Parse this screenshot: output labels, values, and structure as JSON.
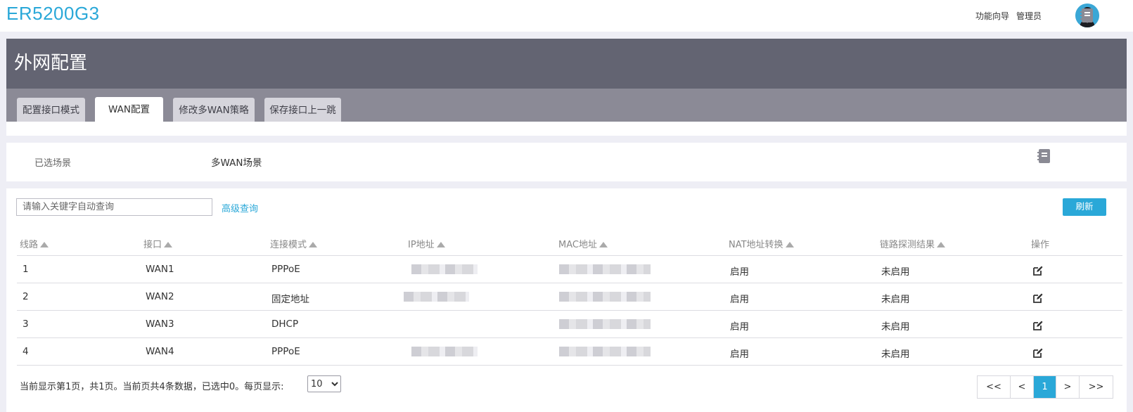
{
  "app": {
    "brand": "ER5200G3"
  },
  "topbar": {
    "wizard_link": "功能向导",
    "user_label": "管理员"
  },
  "page": {
    "title": "外网配置"
  },
  "tabs": [
    {
      "label": "配置接口模式",
      "active": false
    },
    {
      "label": "WAN配置",
      "active": true
    },
    {
      "label": "修改多WAN策略",
      "active": false
    },
    {
      "label": "保存接口上一跳",
      "active": false
    }
  ],
  "scene": {
    "label": "已选场景",
    "value": "多WAN场景"
  },
  "toolbar": {
    "search_placeholder": "请输入关键字自动查询",
    "advanced_search": "高级查询",
    "refresh": "刷新"
  },
  "table": {
    "headers": {
      "line": "线路",
      "iface": "接口",
      "mode": "连接模式",
      "ip": "IP地址",
      "mac": "MAC地址",
      "nat": "NAT地址转换",
      "probe": "链路探测结果",
      "ops": "操作"
    },
    "rows": [
      {
        "line": "1",
        "iface": "WAN1",
        "mode": "PPPoE",
        "ip_masked": true,
        "mac_masked": true,
        "nat": "启用",
        "probe": "未启用"
      },
      {
        "line": "2",
        "iface": "WAN2",
        "mode": "固定地址",
        "ip_masked": true,
        "mac_masked": true,
        "nat": "启用",
        "probe": "未启用"
      },
      {
        "line": "3",
        "iface": "WAN3",
        "mode": "DHCP",
        "ip_masked": false,
        "mac_masked": true,
        "nat": "启用",
        "probe": "未启用"
      },
      {
        "line": "4",
        "iface": "WAN4",
        "mode": "PPPoE",
        "ip_masked": true,
        "mac_masked": true,
        "nat": "启用",
        "probe": "未启用"
      }
    ]
  },
  "footer": {
    "status": "当前显示第1页，共1页。当前页共4条数据，已选中0。每页显示:",
    "page_size": "10",
    "pager": {
      "first": "<<",
      "prev": "<",
      "current": "1",
      "next": ">",
      "last": ">>"
    }
  },
  "colors": {
    "accent": "#2aa8d8",
    "header_dark": "#636472",
    "tab_strip": "#8b8a96"
  },
  "icons": {
    "avatar": "user-avatar",
    "notebook": "notebook-icon",
    "edit": "edit-icon"
  }
}
